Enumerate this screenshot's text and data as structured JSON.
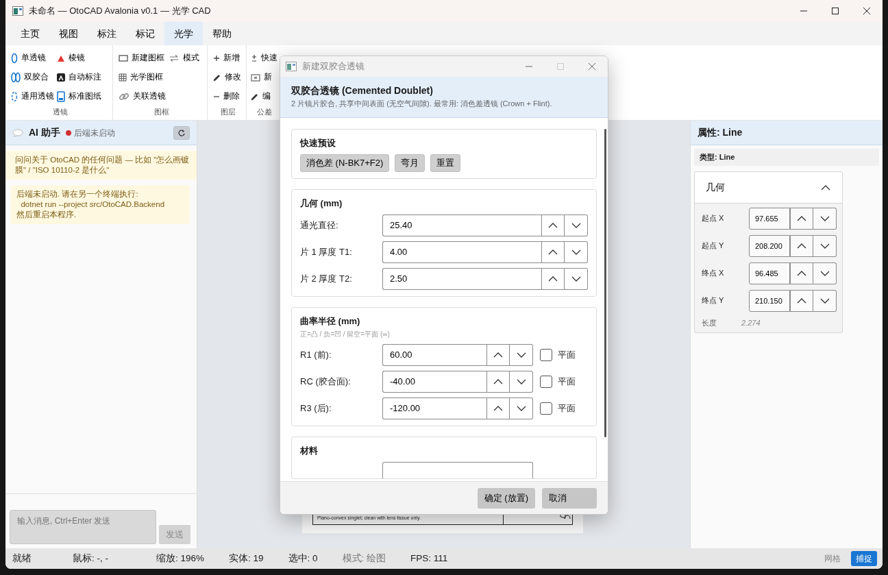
{
  "window": {
    "title": "未命名 — OtoCAD Avalonia v0.1 — 光学 CAD"
  },
  "menu_tabs": [
    {
      "label": "主页",
      "selected": false
    },
    {
      "label": "视图",
      "selected": false
    },
    {
      "label": "标注",
      "selected": false
    },
    {
      "label": "标记",
      "selected": false
    },
    {
      "label": "光学",
      "selected": true
    },
    {
      "label": "帮助",
      "selected": false
    }
  ],
  "ribbon": {
    "groups": [
      {
        "label": "透镜",
        "columns": [
          [
            {
              "label": "单透镜",
              "kind": "lens"
            },
            {
              "label": "双胶合",
              "kind": "doublet"
            },
            {
              "label": "通用透镜",
              "kind": "general-lens"
            }
          ],
          [
            {
              "label": "棱镜",
              "kind": "prism"
            },
            {
              "label": "自动标注",
              "kind": "auto-label"
            },
            {
              "label": "标准图纸",
              "kind": "sheet"
            }
          ]
        ]
      },
      {
        "label": "图框",
        "columns": [
          [
            {
              "label": "新建图框",
              "kind": "frame"
            },
            {
              "label": "光学图框",
              "kind": "optical-frame"
            },
            {
              "label": "关联透镜",
              "kind": "link"
            }
          ],
          [
            {
              "label": "模式",
              "kind": "mode"
            }
          ]
        ]
      },
      {
        "label": "图层",
        "columns": [
          [
            {
              "label": "新增",
              "kind": "add"
            },
            {
              "label": "修改",
              "kind": "edit"
            },
            {
              "label": "删除",
              "kind": "delete"
            }
          ]
        ]
      },
      {
        "label": "公差",
        "columns": [
          [
            {
              "label": "快速",
              "kind": "plus-minus"
            },
            {
              "label": "新",
              "kind": "new-box"
            },
            {
              "label": "编",
              "kind": "edit"
            }
          ]
        ]
      }
    ]
  },
  "assistant": {
    "title": "AI 助手",
    "status": "后端未启动",
    "online": false,
    "messages": [
      {
        "kind": "hint",
        "text": "问问关于 OtoCAD 的任何问题 — 比如 \"怎么画镀膜\" / \"ISO 10110-2 是什么\""
      },
      {
        "kind": "error",
        "text": "后端未启动. 请在另一个终端执行:\n  dotnet run --project src/OtoCAD.Backend\n然后重启本程序."
      }
    ],
    "input": {
      "placeholder": "输入消息, Ctrl+Enter 发送"
    },
    "send": {
      "label": "发送",
      "disabled": true
    }
  },
  "sheet": {
    "notes": [
      "Plano-convex singlet; clean with lens tissue only."
    ]
  },
  "dialog": {
    "title": "新建双胶合透镜",
    "heading": "双胶合透镜 (Cemented Doublet)",
    "description": "2 片镜片胶合, 共享中间表面 (无空气间隙). 最常用: 消色差透镜 (Crown + Flint).",
    "sections": [
      {
        "kind": "presets",
        "title": "快速预设",
        "buttons": [
          "消色差 (N-BK7+F2)",
          "弯月",
          "重置"
        ]
      },
      {
        "kind": "fields",
        "title": "几何 (mm)",
        "fields": [
          {
            "label": "通光直径:",
            "value": "25.40"
          },
          {
            "label": "片 1 厚度 T1:",
            "value": "4.00"
          },
          {
            "label": "片 2 厚度 T2:",
            "value": "2.50"
          }
        ]
      },
      {
        "kind": "fields",
        "title": "曲率半径 (mm)",
        "hint": "正=凸 / 负=凹 / 留空=平面 (∞)",
        "fields": [
          {
            "label": "R1 (前):",
            "value": "60.00",
            "flat": {
              "label": "平面",
              "checked": false
            }
          },
          {
            "label": "RC (胶合面):",
            "value": "-40.00",
            "flat": {
              "label": "平面",
              "checked": false
            }
          },
          {
            "label": "R3 (后):",
            "value": "-120.00",
            "flat": {
              "label": "平面",
              "checked": false
            }
          }
        ]
      },
      {
        "kind": "partial",
        "title": "材料"
      }
    ],
    "buttons": [
      "确定 (放置)",
      "取消"
    ]
  },
  "properties": {
    "title": "属性: Line",
    "type_label": "类型: Line",
    "group": {
      "title": "几何",
      "expanded": true,
      "fields": [
        {
          "label": "起点 X",
          "value": "97.655"
        },
        {
          "label": "起点 Y",
          "value": "208.200"
        },
        {
          "label": "终点 X",
          "value": "96.485"
        },
        {
          "label": "终点 Y",
          "value": "210.150"
        }
      ],
      "length": {
        "label": "长度",
        "value": "2.274"
      }
    }
  },
  "status_bar": {
    "items": [
      {
        "text": "就绪",
        "muted": false
      },
      {
        "text": "鼠标: -, -",
        "muted": false
      },
      {
        "text": "缩放: 196%",
        "muted": false
      },
      {
        "text": "实体: 19",
        "muted": false
      },
      {
        "text": "选中: 0",
        "muted": false
      },
      {
        "text": "模式: 绘图",
        "muted": true
      },
      {
        "text": "FPS: 111",
        "muted": false
      }
    ],
    "toggles": [
      {
        "label": "网格",
        "on": false
      },
      {
        "label": "捕捉",
        "on": true
      }
    ]
  }
}
